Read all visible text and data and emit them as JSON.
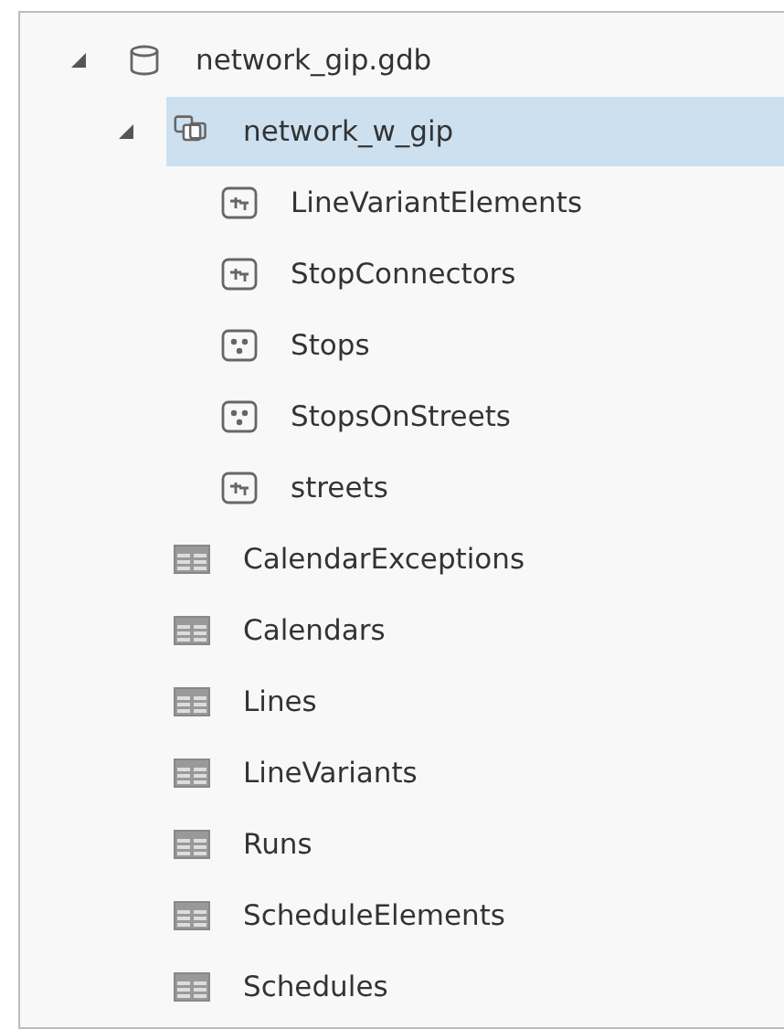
{
  "tree": [
    {
      "label": "network_gip.gdb",
      "kind": "geodatabase",
      "expanded": true,
      "selected": false,
      "children": [
        {
          "label": "network_w_gip",
          "kind": "dataset",
          "expanded": true,
          "selected": true,
          "children": [
            {
              "label": "LineVariantElements",
              "kind": "line",
              "selected": false
            },
            {
              "label": "StopConnectors",
              "kind": "line",
              "selected": false
            },
            {
              "label": "Stops",
              "kind": "point",
              "selected": false
            },
            {
              "label": "StopsOnStreets",
              "kind": "point",
              "selected": false
            },
            {
              "label": "streets",
              "kind": "line",
              "selected": false
            }
          ]
        },
        {
          "label": "CalendarExceptions",
          "kind": "table",
          "selected": false
        },
        {
          "label": "Calendars",
          "kind": "table",
          "selected": false
        },
        {
          "label": "Lines",
          "kind": "table",
          "selected": false
        },
        {
          "label": "LineVariants",
          "kind": "table",
          "selected": false
        },
        {
          "label": "Runs",
          "kind": "table",
          "selected": false
        },
        {
          "label": "ScheduleElements",
          "kind": "table",
          "selected": false
        },
        {
          "label": "Schedules",
          "kind": "table",
          "selected": false
        }
      ]
    }
  ]
}
